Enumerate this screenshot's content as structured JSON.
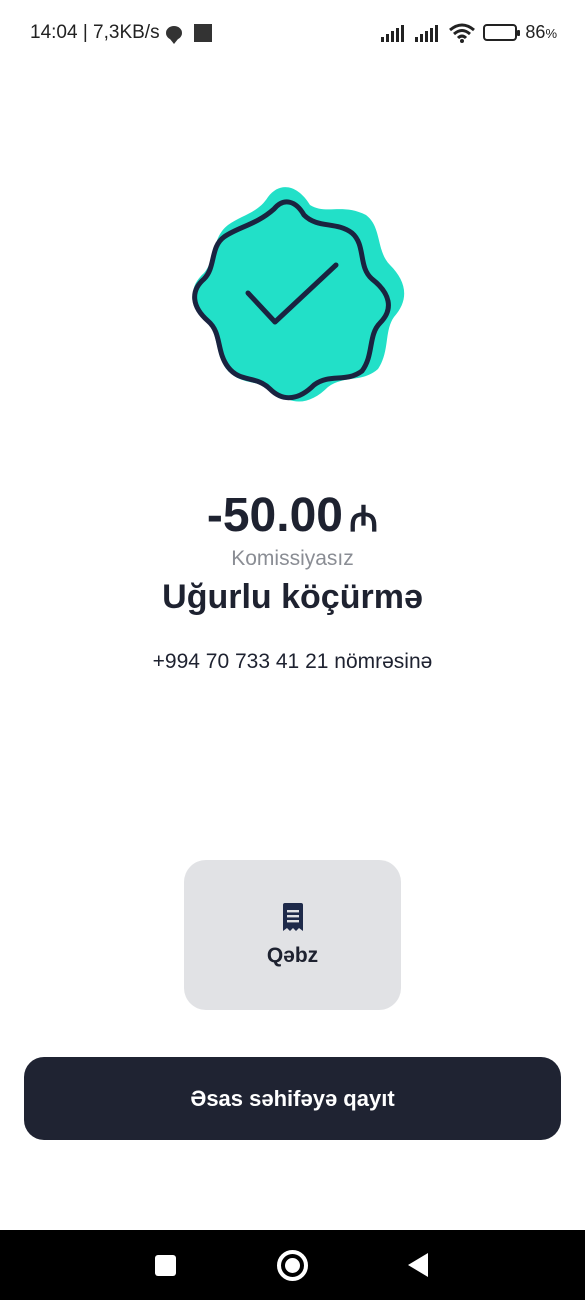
{
  "status_bar": {
    "time_speed": "14:04 | 7,3KB/s",
    "battery_percent": "86",
    "battery_percent_sign": "%",
    "battery_level": 0.86
  },
  "badge": {
    "icon": "check-badge-icon",
    "fill_color": "#22e0c8",
    "outline_color": "#1a2340"
  },
  "transfer": {
    "amount": "-50.00",
    "currency": "₼",
    "fee_note": "Komissiyasız",
    "title": "Uğurlu köçürmə",
    "recipient": "+994 70 733 41 21 nömrəsinə"
  },
  "receipt": {
    "label": "Qəbz",
    "icon": "receipt-icon"
  },
  "home_button": {
    "label": "Əsas səhifəyə qayıt"
  },
  "nav": {
    "recents": "square-icon",
    "home": "circle-icon",
    "back": "triangle-back-icon"
  }
}
